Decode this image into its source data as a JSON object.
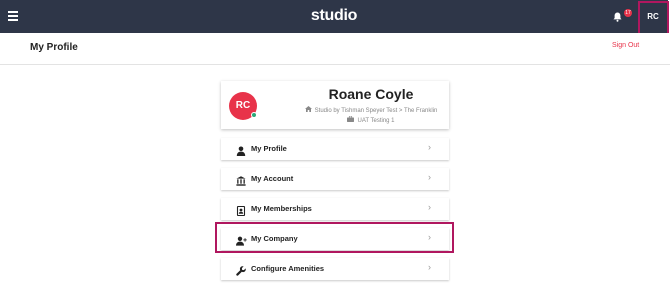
{
  "topbar": {
    "logo": "studio",
    "notification_count": "17",
    "avatar_initials": "RC"
  },
  "subheader": {
    "title": "My Profile",
    "sign_out": "Sign Out"
  },
  "profile": {
    "initials": "RC",
    "name": "Roane Coyle",
    "location": "Studio by Tishman Speyer Test > The Franklin",
    "tenant": "UAT Testing 1"
  },
  "menu": [
    {
      "label": "My Profile",
      "icon": "person-icon"
    },
    {
      "label": "My Account",
      "icon": "bank-icon"
    },
    {
      "label": "My Memberships",
      "icon": "badge-icon"
    },
    {
      "label": "My Company",
      "icon": "add-user-icon"
    },
    {
      "label": "Configure Amenities",
      "icon": "wrench-icon"
    }
  ],
  "colors": {
    "topbar_bg": "#2e3648",
    "accent_red": "#e8334a",
    "highlight": "#b0175f",
    "status_online": "#2aa776"
  }
}
